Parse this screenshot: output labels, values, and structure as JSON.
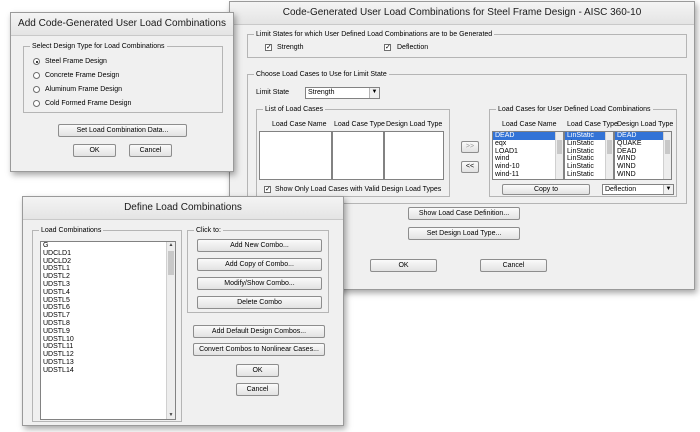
{
  "steel_dialog": {
    "title": "Code-Generated User Load Combinations for Steel Frame Design - AISC 360-10",
    "limit_states_group": "Limit States for which User Defined Load Combinations are to be Generated",
    "strength_label": "Strength",
    "deflection_label": "Deflection",
    "choose_group": "Choose Load Cases to Use for Limit State",
    "limit_state_label": "Limit State",
    "limit_state_value": "Strength",
    "list_group": "List of Load Cases",
    "col_name": "Load Case Name",
    "col_type": "Load Case Type",
    "col_design": "Design Load Type",
    "show_only_label": "Show Only Load Cases with Valid Design Load Types",
    "add_arrow": ">>",
    "remove_arrow": "<<",
    "user_group": "Load Cases for User Defined Load Combinations",
    "names": [
      "DEAD",
      "eqx",
      "LOAD1",
      "wind",
      "wind-10",
      "wind-11"
    ],
    "types": [
      "LinStatic",
      "LinStatic",
      "LinStatic",
      "LinStatic",
      "LinStatic",
      "LinStatic"
    ],
    "design_types": [
      "DEAD",
      "QUAKE",
      "DEAD",
      "WIND",
      "WIND",
      "WIND"
    ],
    "copy_to": "Copy to",
    "copy_to_value": "Deflection",
    "show_definition": "Show Load Case Definition...",
    "set_design_type": "Set Design Load Type...",
    "ok": "OK",
    "cancel": "Cancel"
  },
  "add_dialog": {
    "title": "Add Code-Generated User Load Combinations",
    "group": "Select Design Type for Load Combinations",
    "options": [
      "Steel Frame Design",
      "Concrete Frame Design",
      "Aluminum Frame Design",
      "Cold Formed Frame Design"
    ],
    "set_data": "Set Load Combination Data...",
    "ok": "OK",
    "cancel": "Cancel"
  },
  "define_dialog": {
    "title": "Define Load Combinations",
    "list_group": "Load Combinations",
    "items": [
      "G",
      "UDCLD1",
      "UDCLD2",
      "UDSTL1",
      "UDSTL2",
      "UDSTL3",
      "UDSTL4",
      "UDSTL5",
      "UDSTL6",
      "UDSTL7",
      "UDSTL8",
      "UDSTL9",
      "UDSTL10",
      "UDSTL11",
      "UDSTL12",
      "UDSTL13",
      "UDSTL14"
    ],
    "click_group": "Click to:",
    "add_new": "Add New Combo...",
    "add_copy": "Add Copy of Combo...",
    "modify": "Modify/Show Combo...",
    "delete": "Delete Combo",
    "add_default": "Add Default Design Combos...",
    "convert": "Convert Combos to Nonlinear Cases...",
    "ok": "OK",
    "cancel": "Cancel"
  }
}
